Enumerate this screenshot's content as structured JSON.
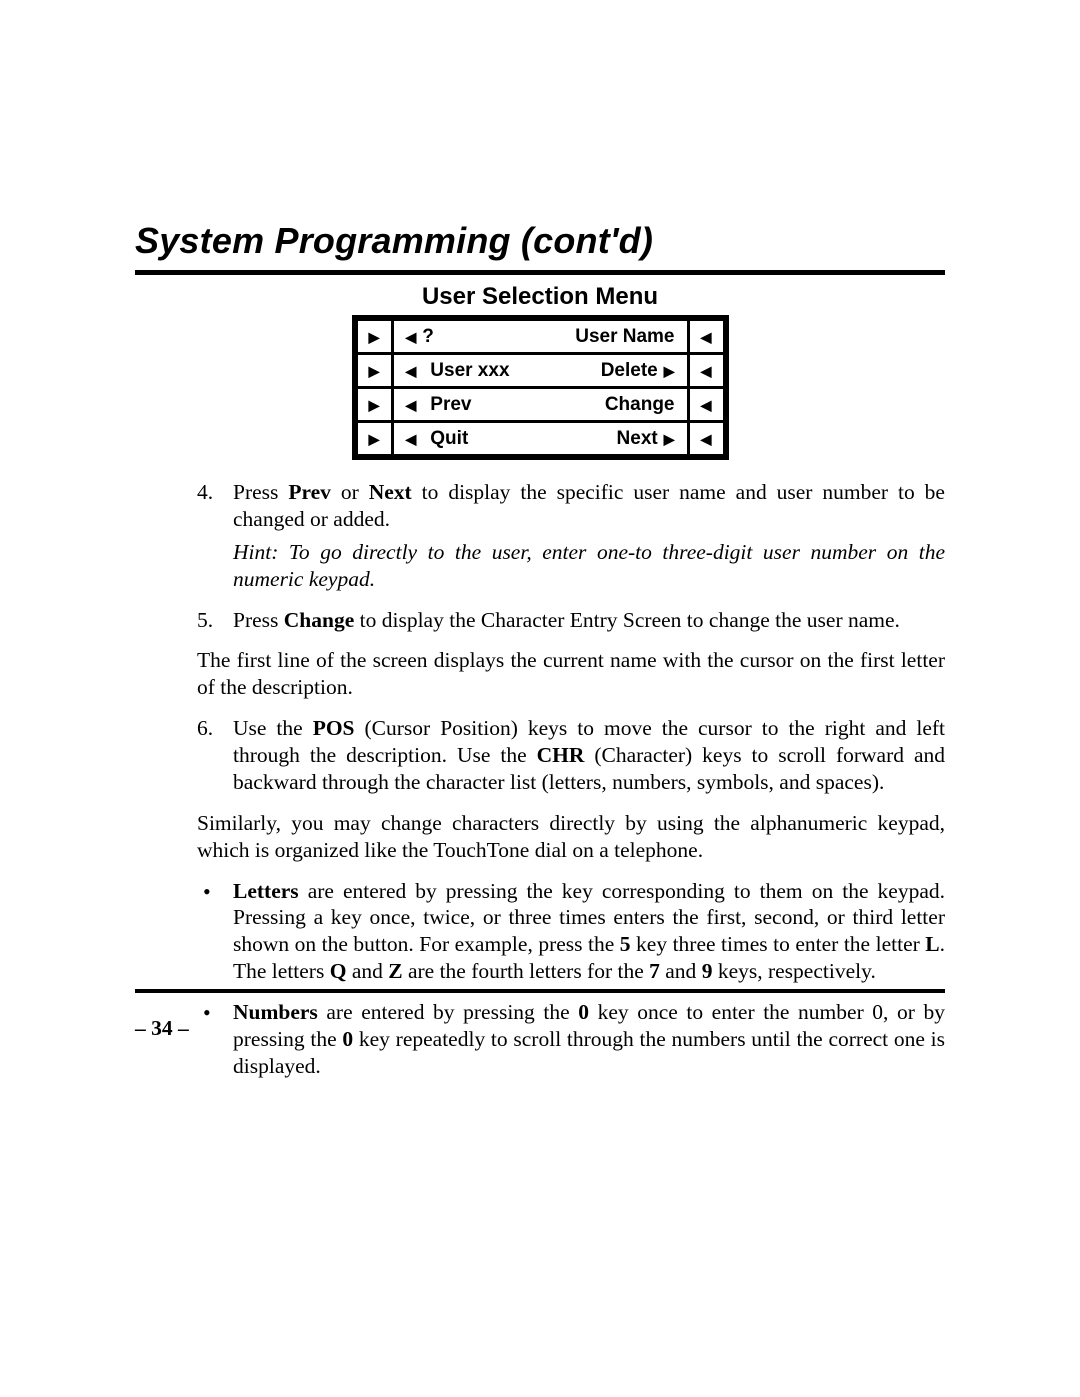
{
  "heading": "System Programming (cont'd)",
  "menu": {
    "title": "User Selection Menu",
    "rows": [
      {
        "left_question": "?",
        "left_text": "",
        "right_text": "User Name",
        "right_arrow": false
      },
      {
        "left_question": "",
        "left_text": "User xxx",
        "right_text": "Delete",
        "right_arrow": true
      },
      {
        "left_question": "",
        "left_text": "Prev",
        "right_text": "Change",
        "right_arrow": false
      },
      {
        "left_question": "",
        "left_text": "Quit",
        "right_text": "Next",
        "right_arrow": true
      }
    ]
  },
  "steps": {
    "s4": {
      "num": "4.",
      "pre": "Press ",
      "b1": "Prev",
      "mid1": " or ",
      "b2": "Next",
      "post": " to display the specific user name and user number to be changed or added.",
      "hint": "Hint: To go directly to the user, enter one-to three-digit user number on the numeric keypad."
    },
    "s5": {
      "num": "5.",
      "pre": "Press ",
      "b1": "Change",
      "post": " to display the Character Entry Screen to change the user name."
    },
    "s6": {
      "num": "6.",
      "pre": "Use the ",
      "b1": "POS",
      "mid1": " (Cursor Position) keys to move the cursor to the right and left through the description. Use the ",
      "b2": "CHR",
      "post": " (Character) keys to scroll forward and backward through the character list (letters, numbers, symbols, and spaces)."
    }
  },
  "paras": {
    "p1": "The first line of the screen displays the current name with the cursor on the first letter of the description.",
    "p2": "Similarly, you may change characters directly by using the alphanumeric keypad, which is organized like the TouchTone dial on a telephone."
  },
  "bullets": {
    "letters": {
      "b1": "Letters",
      "t1": " are entered by pressing the key corresponding to them on the keypad. Pressing a key once, twice, or three times enters the first, second, or third letter shown on the button. For example, press the ",
      "b2": "5",
      "t2": " key three times to enter the letter ",
      "b3": "L",
      "t3": ". The letters ",
      "b4": "Q",
      "t4": " and ",
      "b5": "Z",
      "t5": " are the fourth letters for the ",
      "b6": "7",
      "t6": " and ",
      "b7": "9",
      "t7": " keys, respectively."
    },
    "numbers": {
      "b1": "Numbers",
      "t1": " are entered by pressing the ",
      "b2": "0",
      "t2": " key once to enter the number 0, or by pressing the ",
      "b3": "0",
      "t3": " key repeatedly to scroll through the numbers until the correct one is displayed."
    }
  },
  "page_num": "– 34 –"
}
